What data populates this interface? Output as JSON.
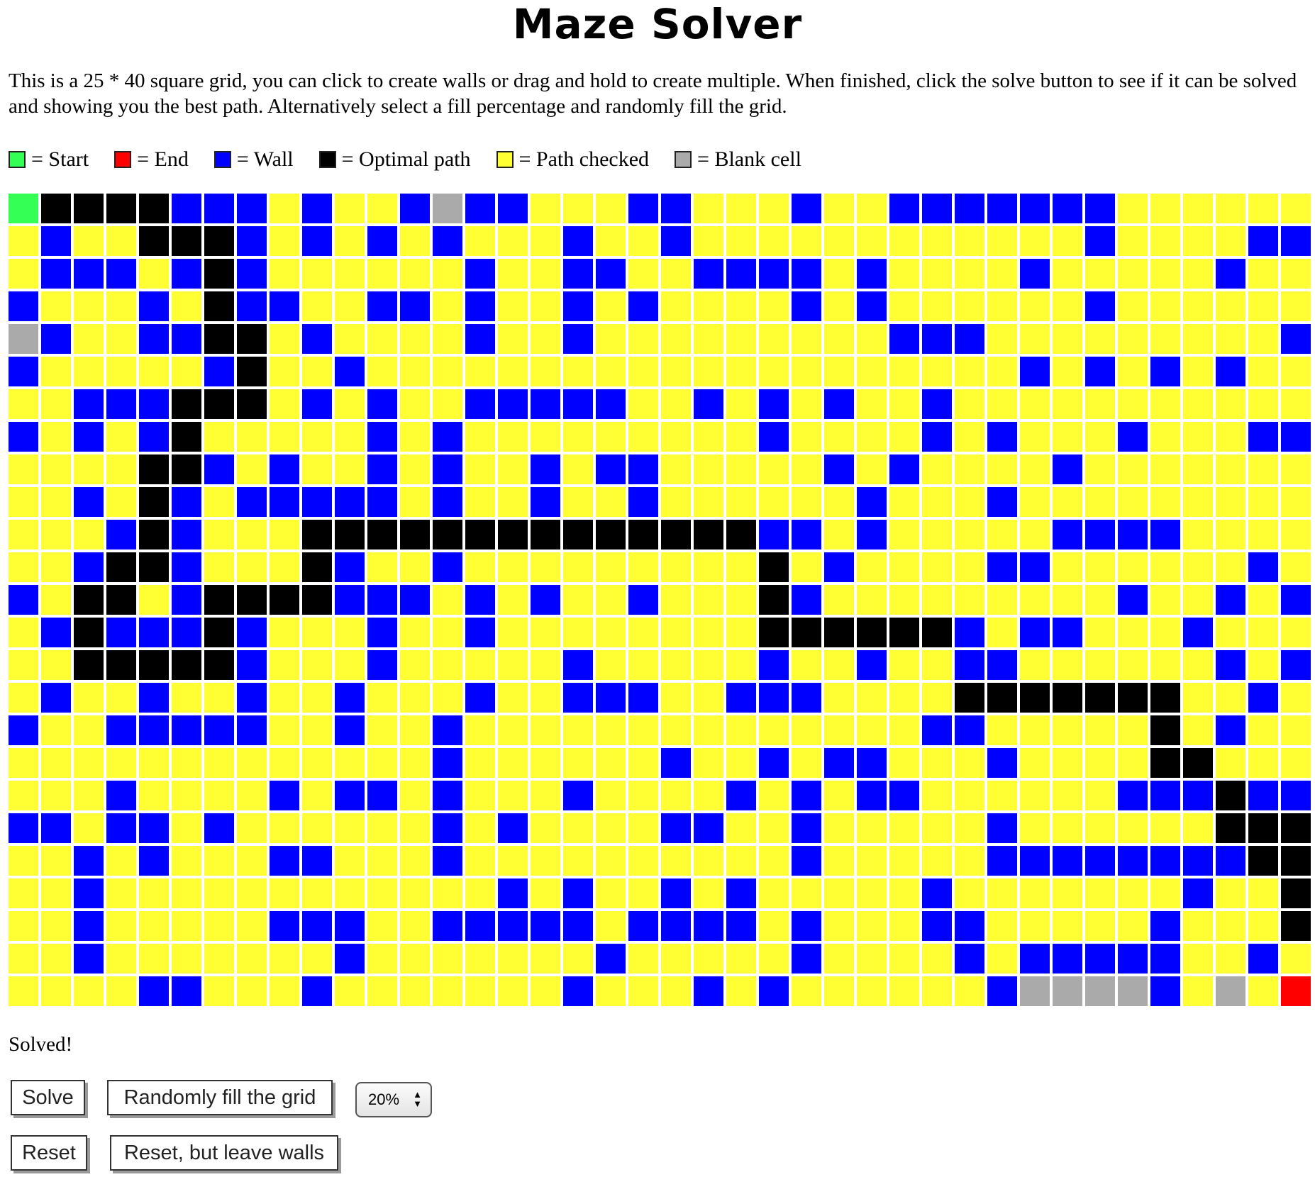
{
  "title": "Maze Solver",
  "intro": "This is a 25 * 40 square grid, you can click to create walls or drag and hold to create multiple. When finished, click the solve button to see if it can be solved and showing you the best path. Alternatively select a fill percentage and randomly fill the grid.",
  "legend": [
    {
      "label": "= Start",
      "color": "#33ff55"
    },
    {
      "label": "= End",
      "color": "#ff0000"
    },
    {
      "label": "= Wall",
      "color": "#0000ff"
    },
    {
      "label": "= Optimal path",
      "color": "#000000"
    },
    {
      "label": "= Path checked",
      "color": "#ffff33"
    },
    {
      "label": "= Blank cell",
      "color": "#aaaaaa"
    }
  ],
  "colors": {
    "S": "#33ff55",
    "E": "#ff0000",
    "W": "#0000ff",
    "P": "#000000",
    "Y": "#ffff33",
    "B": "#aaaaaa"
  },
  "grid": {
    "rows": 25,
    "cols": 40,
    "legend_codes": "S=start, E=end, W=wall, P=optimal path, Y=path checked, B=blank cell",
    "cells": [
      "SPPPPWWWYWYYWBWWYYYWWYYYWYYWWWWWWWYYYYYY",
      "YWYYPPPWYWYWYWYYYWYYWYYYYYYYYYYYYWYYYYWW",
      "YWWWYWPWYYYYYYWYYWWYYWWWWYWYYYYWYYYYYWYY",
      "WYYYWYPWWYYWWYWYYWYWYYYYWYWYYYYYYWYYYYYY",
      "BWYYWWPPYWYYYYWYYWYYYYYYYYYWWWYYYYYYYYYW",
      "WYYYYYWPYYWYYYYYYYYYYYYYYYYYYYYWYWYWYWYY",
      "YYWWWPPPYWYWYYWWWWWYYWYWYWYYWYYYYYYYYYYY",
      "WYWYWPYYYYYWYWYYYYYYYYYWYYYYWYWYYYWYYYWW",
      "YYYYPPWYWYYWYWYYWYWWYYYYYWYWYYYYWYYYYYYY",
      "YYWYPWYWWWWWYWYYWYYWYYYYYYWYYYWYYYYYYYYY",
      "YYYWPWYYYPPPPPPPPPPPPPPWWYWYYYYYWWWWYYYY",
      "YYWPPWYYYPWYYWYYYYYYYYYPYWYYYYWWYYYYYYWY",
      "WYPPYWPPPPWWWYWYWYYWYYYPWYYYYYYYYYWYYWYW",
      "YWPWWWPWYYYWYYWYYYYYYYYPPPPPPWYWWYYYWYYY",
      "YYPPPPPWYYYWYYYYYWYYYYYWYYWYYWWYYYYYYWYW",
      "YWYYWYYWYYWYYYWYYWWWYYWWWYYYYPPPPPPPYYWY",
      "WYYWWWWWYYWYYWYYYYYYYYYYYYYYWWYYYYYPYWYY",
      "YYYYYYYYYYYYYWYYYYYYWYYWYWWYYYWYYYYPPYYY",
      "YYYWYYYYWYWWYWYYYWYYYYWYWYWWYYYYYYWWWPWW",
      "WWYWWYWYYYYYYWYWYYYYWWYYWYYYYYWYYYYYYPPPW",
      "YYWYWYYYWWYYYWYYYYYYYYYYWYYYYYWWWWWWWWPPP",
      "YYWYYYYYYYYYYYYWYWYYWYWYYYYYWYYYYYYYWYYP",
      "YYWYYYYYWWWYYWWWWWYWWWWYWYYYWWYYYYYWYYYP",
      "YYWYYYYYYYWYYYYYYYWYYYYYWYYYYWYWWWWWYYWYP",
      "YYYYWWYYYWYYYYYYYWYYYWYWYYYYYYWBBBBWYBYE"
    ]
  },
  "status": "Solved!",
  "buttons": {
    "solve": "Solve",
    "random_fill": "Randomly fill the grid",
    "reset": "Reset",
    "reset_keep_walls": "Reset, but leave walls"
  },
  "fill_select": {
    "selected": "20%",
    "arrows": "▲▼"
  }
}
